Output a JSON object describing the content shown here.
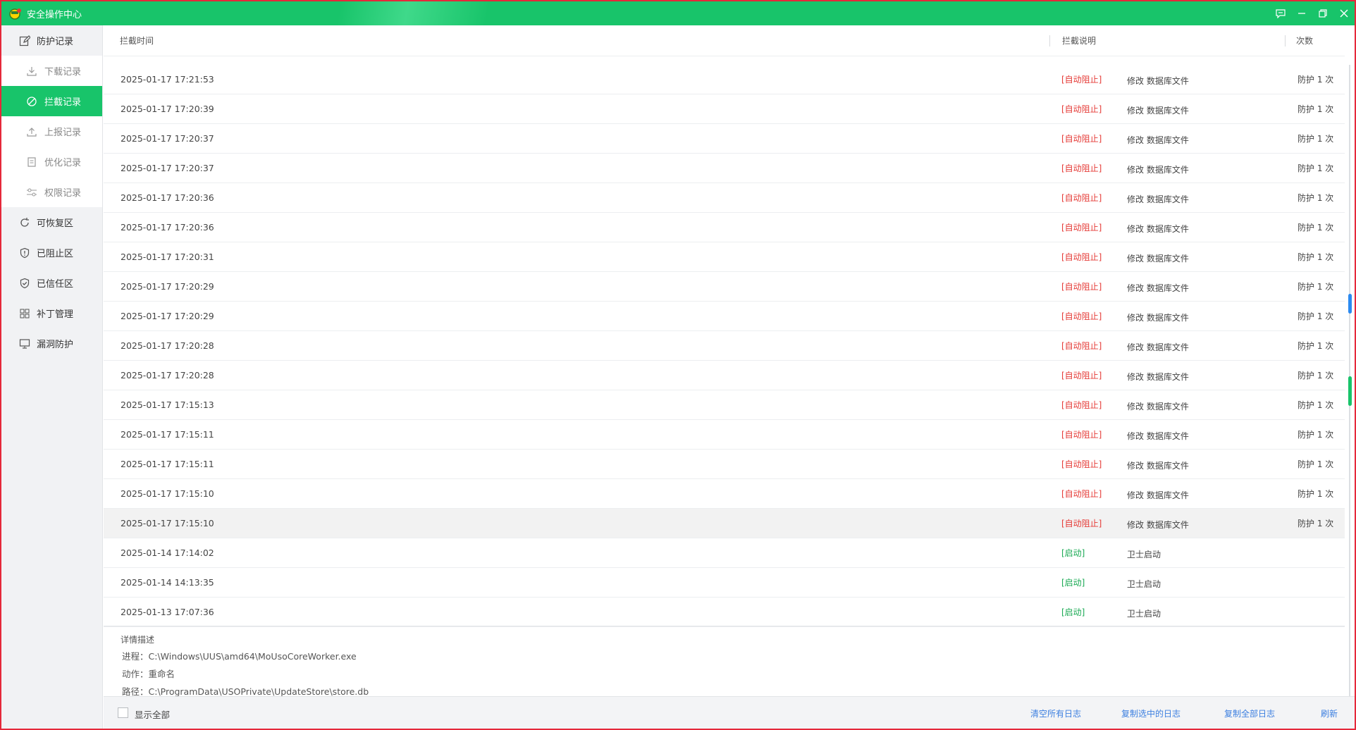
{
  "app": {
    "title": "安全操作中心"
  },
  "window_controls": {
    "feedback_icon": "feedback-icon",
    "minimize_icon": "minimize-icon",
    "restore_icon": "restore-icon",
    "close_icon": "close-icon"
  },
  "colors": {
    "accent": "#18c46a",
    "danger": "#e53935",
    "ok": "#18a952",
    "link": "#3c7fe0"
  },
  "sidebar": {
    "items": [
      {
        "label": "防护记录",
        "icon": "edit-icon"
      },
      {
        "label": "下载记录",
        "icon": "download-icon",
        "sub": true
      },
      {
        "label": "拦截记录",
        "icon": "block-icon",
        "sub": true,
        "active": true
      },
      {
        "label": "上报记录",
        "icon": "upload-icon",
        "sub": true
      },
      {
        "label": "优化记录",
        "icon": "document-icon",
        "sub": true
      },
      {
        "label": "权限记录",
        "icon": "settings-sliders-icon",
        "sub": true
      },
      {
        "label": "可恢复区",
        "icon": "restore-circle-icon"
      },
      {
        "label": "已阻止区",
        "icon": "shield-icon"
      },
      {
        "label": "已信任区",
        "icon": "shield-check-icon"
      },
      {
        "label": "补丁管理",
        "icon": "grid-icon"
      },
      {
        "label": "漏洞防护",
        "icon": "monitor-icon"
      }
    ]
  },
  "table": {
    "headers": {
      "time": "拦截时间",
      "desc": "拦截说明",
      "count": "次数"
    },
    "rows": [
      {
        "time": "2025-01-17 17:21:53",
        "tag": "[自动阻止]",
        "tag_type": "red",
        "desc": "修改 数据库文件",
        "count": "防护 1 次"
      },
      {
        "time": "2025-01-17 17:20:39",
        "tag": "[自动阻止]",
        "tag_type": "red",
        "desc": "修改 数据库文件",
        "count": "防护 1 次"
      },
      {
        "time": "2025-01-17 17:20:37",
        "tag": "[自动阻止]",
        "tag_type": "red",
        "desc": "修改 数据库文件",
        "count": "防护 1 次"
      },
      {
        "time": "2025-01-17 17:20:37",
        "tag": "[自动阻止]",
        "tag_type": "red",
        "desc": "修改 数据库文件",
        "count": "防护 1 次"
      },
      {
        "time": "2025-01-17 17:20:36",
        "tag": "[自动阻止]",
        "tag_type": "red",
        "desc": "修改 数据库文件",
        "count": "防护 1 次"
      },
      {
        "time": "2025-01-17 17:20:36",
        "tag": "[自动阻止]",
        "tag_type": "red",
        "desc": "修改 数据库文件",
        "count": "防护 1 次"
      },
      {
        "time": "2025-01-17 17:20:31",
        "tag": "[自动阻止]",
        "tag_type": "red",
        "desc": "修改 数据库文件",
        "count": "防护 1 次"
      },
      {
        "time": "2025-01-17 17:20:29",
        "tag": "[自动阻止]",
        "tag_type": "red",
        "desc": "修改 数据库文件",
        "count": "防护 1 次"
      },
      {
        "time": "2025-01-17 17:20:29",
        "tag": "[自动阻止]",
        "tag_type": "red",
        "desc": "修改 数据库文件",
        "count": "防护 1 次"
      },
      {
        "time": "2025-01-17 17:20:28",
        "tag": "[自动阻止]",
        "tag_type": "red",
        "desc": "修改 数据库文件",
        "count": "防护 1 次"
      },
      {
        "time": "2025-01-17 17:20:28",
        "tag": "[自动阻止]",
        "tag_type": "red",
        "desc": "修改 数据库文件",
        "count": "防护 1 次"
      },
      {
        "time": "2025-01-17 17:15:13",
        "tag": "[自动阻止]",
        "tag_type": "red",
        "desc": "修改 数据库文件",
        "count": "防护 1 次"
      },
      {
        "time": "2025-01-17 17:15:11",
        "tag": "[自动阻止]",
        "tag_type": "red",
        "desc": "修改 数据库文件",
        "count": "防护 1 次"
      },
      {
        "time": "2025-01-17 17:15:11",
        "tag": "[自动阻止]",
        "tag_type": "red",
        "desc": "修改 数据库文件",
        "count": "防护 1 次"
      },
      {
        "time": "2025-01-17 17:15:10",
        "tag": "[自动阻止]",
        "tag_type": "red",
        "desc": "修改 数据库文件",
        "count": "防护 1 次"
      },
      {
        "time": "2025-01-17 17:15:10",
        "tag": "[自动阻止]",
        "tag_type": "red",
        "desc": "修改 数据库文件",
        "count": "防护 1 次",
        "hover": true
      },
      {
        "time": "2025-01-14 17:14:02",
        "tag": "[启动]",
        "tag_type": "green",
        "desc": "卫士启动",
        "count": ""
      },
      {
        "time": "2025-01-14 14:13:35",
        "tag": "[启动]",
        "tag_type": "green",
        "desc": "卫士启动",
        "count": ""
      },
      {
        "time": "2025-01-13 17:07:36",
        "tag": "[启动]",
        "tag_type": "green",
        "desc": "卫士启动",
        "count": ""
      }
    ]
  },
  "details": {
    "title": "详情描述",
    "process": "进程：C:\\Windows\\UUS\\amd64\\MoUsoCoreWorker.exe",
    "action": "动作：重命名",
    "path": "路径：C:\\ProgramData\\USOPrivate\\UpdateStore\\store.db"
  },
  "footer": {
    "show_all_label": "显示全部",
    "show_all_checked": false,
    "clear_all": "清空所有日志",
    "copy_selected": "复制选中的日志",
    "copy_all": "复制全部日志",
    "refresh": "刷新"
  }
}
